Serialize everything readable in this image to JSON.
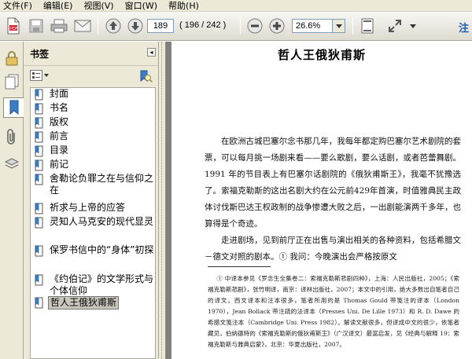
{
  "menu": {
    "items": [
      "文件(F)",
      "编辑(E)",
      "视图(V)",
      "窗口(W)",
      "帮助(H)"
    ]
  },
  "toolbar": {
    "page_current": "189",
    "page_count": "( 196 / 242 )",
    "zoom": "26.6%",
    "note_label": "注"
  },
  "sidebar": {
    "title": "书签",
    "close_glyph": "◂",
    "bookmarks": [
      "封面",
      "书名",
      "版权",
      "前言",
      "目录",
      "前记",
      "舍勒论负罪之在与信仰之在",
      "祈求与上帝的应答",
      "灵知人马克安的现代显灵",
      "保罗书信中的“身体”初探",
      "《约伯记》的文学形式与个体信仰",
      "哲人王俄狄甫斯"
    ],
    "selected_index": 11
  },
  "document": {
    "title": "哲人王俄狄甫斯",
    "paragraphs": [
      "在欧洲古城巴塞尔念书那几年，我每年都定购巴塞尔艺术剧院的套票，可以每月挑一场剧来看——要么歌剧，要么话剧，或者芭蕾舞剧。1991 年的节目表上有巴塞尔话剧院的《俄狄甫斯王》，我毫不犹豫选了。索福克勒斯的这出名剧大约在公元前429年首演，时值雅典民主政体讨伐斯巴达王权政制的战争惨遭大败之后，一出剧能演两千多年，也算得是个奇迹。",
      "走进剧场，见到前厅正在出售与演出相关的各种资料，包括希腊文－德文对照的剧本。① 我问：今晚演出会严格按原文"
    ],
    "footnote": [
      "① 中译本参见《罗念生全集卷二：索福克勒斯悲剧四种》，上海：人民出版社，2005；《索福克勒斯悲剧》，张竹明译，南京：译林出版社，2007；本文中的引用，绝大多数出自笔者自己的译文。西文译本和注本很多，笔者所用的是 Thomas Gould 带笺注的译本（London 1970），Jean Bollack 带注疏的法译本（Presses Uni. De Lille 1973）和 R. D. Dawe 的希腊文笺注本（Cambridge Uni. Press 1982）。解读文献很多，但译成中文的很少，依笔者藏见，伯纳德特的《索福克勒斯的俄狄甫斯王》（广汉译文）最富启发，见《经典与解释 19：索福克勒斯与雅典启蒙》，北京：华夏出版社，2007。"
    ]
  },
  "colors": {
    "chrome": "#ece9d8",
    "doc_background": "#808080",
    "accent": "#1a5fb4"
  }
}
